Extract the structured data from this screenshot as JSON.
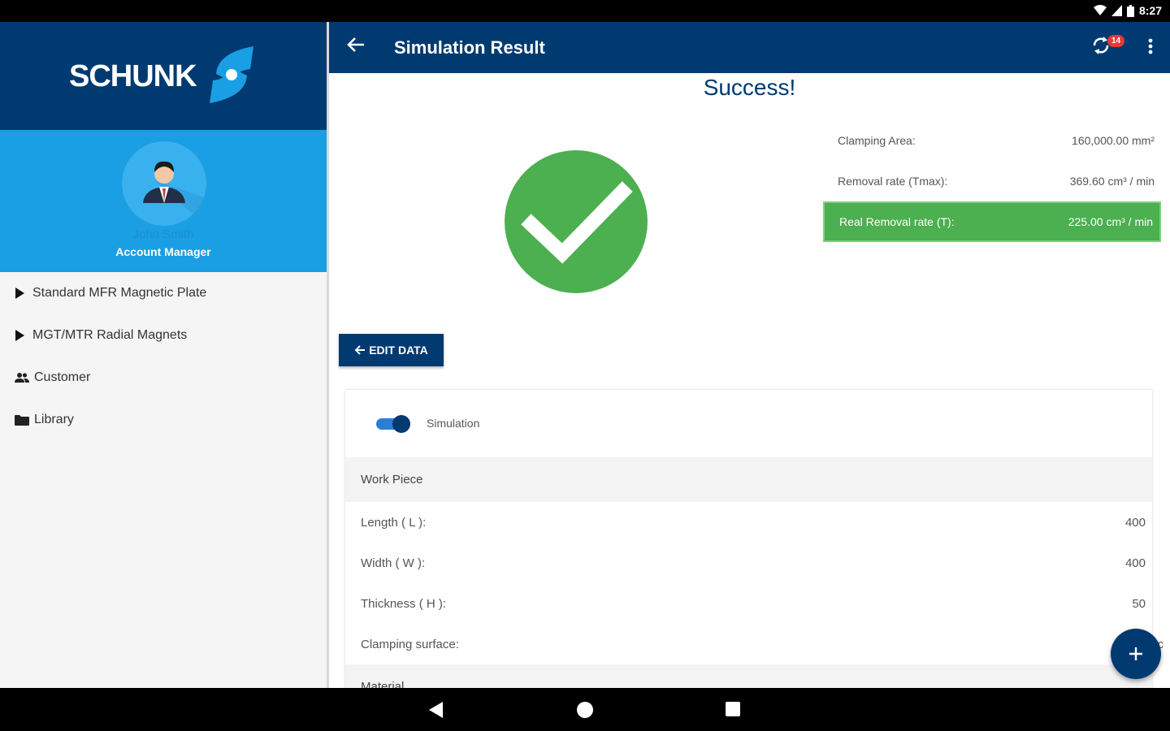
{
  "status_bar": {
    "time": "8:27"
  },
  "sidebar": {
    "brand": "SCHUNK",
    "profile": {
      "name": "John Smith",
      "role": "Account Manager"
    },
    "items": [
      {
        "label": "Standard MFR Magnetic Plate",
        "icon": "triangle-right-icon"
      },
      {
        "label": "MGT/MTR Radial Magnets",
        "icon": "triangle-right-icon"
      },
      {
        "label": "Customer",
        "icon": "people-icon"
      },
      {
        "label": "Library",
        "icon": "folder-icon"
      }
    ]
  },
  "appbar": {
    "title": "Simulation Result",
    "badge_count": "14"
  },
  "result": {
    "heading": "Success!",
    "stats": [
      {
        "label": "Clamping Area:",
        "value": "160,000.00 mm²"
      },
      {
        "label": "Removal rate (Tmax):",
        "value": "369.60 cm³ / min"
      },
      {
        "label": "Real Removal rate (T):",
        "value": "225.00 cm³ / min"
      }
    ],
    "edit_label": "EDIT DATA"
  },
  "card": {
    "toggle_label": "Simulation",
    "toggle_on": true,
    "section_workpiece": "Work Piece",
    "rows": [
      {
        "label": "Length ( L ):",
        "value": "400"
      },
      {
        "label": "Width ( W ):",
        "value": "400"
      },
      {
        "label": "Thickness ( H ):",
        "value": "50"
      },
      {
        "label": "Clamping surface:",
        "value": "Premac"
      }
    ],
    "section_material": "Material"
  },
  "colors": {
    "primary": "#003a70",
    "accent": "#1a9ee4",
    "success": "#4caf50"
  }
}
